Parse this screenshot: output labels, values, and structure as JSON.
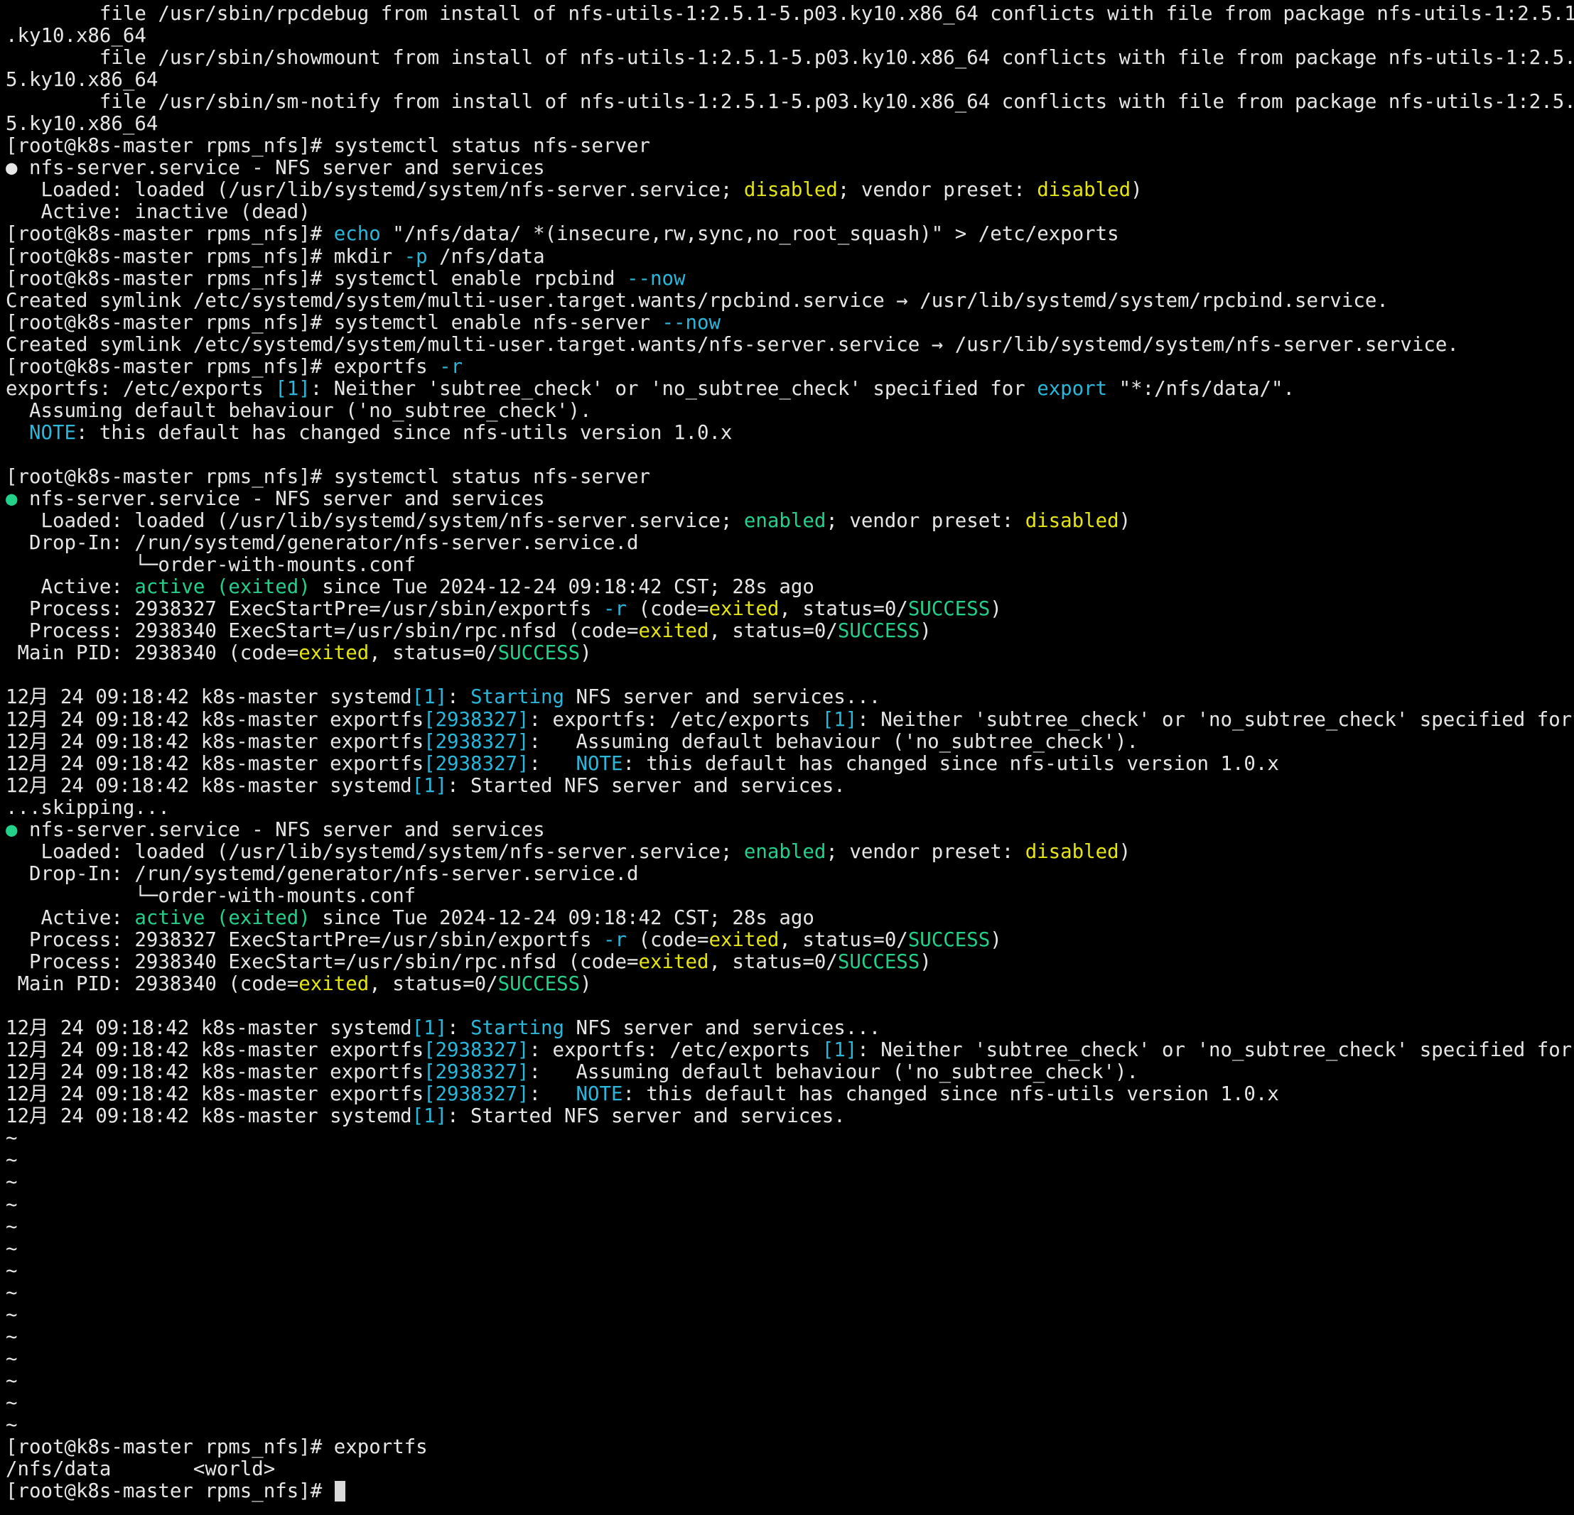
{
  "terminal": {
    "colors": {
      "background": "#000000",
      "foreground": "#e6e6e6",
      "yellow": "#e5e510",
      "cyan": "#29b8db",
      "green": "#23d18b"
    },
    "lines": [
      [
        {
          "t": "        file /usr/sbin/rpcdebug from install of nfs-utils-1:2.5.1-5.p03.ky10.x86_64 conflicts with file from package nfs-utils-1:2.5.1-5"
        }
      ],
      [
        {
          "t": ".ky10.x86_64"
        }
      ],
      [
        {
          "t": "        file /usr/sbin/showmount from install of nfs-utils-1:2.5.1-5.p03.ky10.x86_64 conflicts with file from package nfs-utils-1:2.5.1-"
        }
      ],
      [
        {
          "t": "5.ky10.x86_64"
        }
      ],
      [
        {
          "t": "        file /usr/sbin/sm-notify from install of nfs-utils-1:2.5.1-5.p03.ky10.x86_64 conflicts with file from package nfs-utils-1:2.5.1-"
        }
      ],
      [
        {
          "t": "5.ky10.x86_64"
        }
      ],
      [
        {
          "t": "[root@k8s-master rpms_nfs]# systemctl status nfs-server"
        }
      ],
      [
        {
          "t": "●",
          "c": "dot-w"
        },
        {
          "t": " nfs-server.service - NFS server and services"
        }
      ],
      [
        {
          "t": "   Loaded: loaded (/usr/lib/systemd/system/nfs-server.service; "
        },
        {
          "t": "disabled",
          "c": "y"
        },
        {
          "t": "; vendor preset: "
        },
        {
          "t": "disabled",
          "c": "y"
        },
        {
          "t": ")"
        }
      ],
      [
        {
          "t": "   Active: inactive (dead)"
        }
      ],
      [
        {
          "t": "[root@k8s-master rpms_nfs]# "
        },
        {
          "t": "echo",
          "c": "c"
        },
        {
          "t": " \"/nfs/data/ *(insecure,rw,sync,no_root_squash)\" > /etc/exports"
        }
      ],
      [
        {
          "t": "[root@k8s-master rpms_nfs]# mkdir "
        },
        {
          "t": "-p",
          "c": "c"
        },
        {
          "t": " /nfs/data"
        }
      ],
      [
        {
          "t": "[root@k8s-master rpms_nfs]# systemctl enable rpcbind "
        },
        {
          "t": "--now",
          "c": "c"
        }
      ],
      [
        {
          "t": "Created symlink /etc/systemd/system/multi-user.target.wants/rpcbind.service → /usr/lib/systemd/system/rpcbind.service."
        }
      ],
      [
        {
          "t": "[root@k8s-master rpms_nfs]# systemctl enable nfs-server "
        },
        {
          "t": "--now",
          "c": "c"
        }
      ],
      [
        {
          "t": "Created symlink /etc/systemd/system/multi-user.target.wants/nfs-server.service → /usr/lib/systemd/system/nfs-server.service."
        }
      ],
      [
        {
          "t": "[root@k8s-master rpms_nfs]# exportfs "
        },
        {
          "t": "-r",
          "c": "c"
        }
      ],
      [
        {
          "t": "exportfs: /etc/exports "
        },
        {
          "t": "[1]",
          "c": "c"
        },
        {
          "t": ": Neither 'subtree_check' or 'no_subtree_check' specified for "
        },
        {
          "t": "export",
          "c": "c"
        },
        {
          "t": " \"*:/nfs/data/\"."
        }
      ],
      [
        {
          "t": "  Assuming default behaviour ('no_subtree_check')."
        }
      ],
      [
        {
          "t": "  "
        },
        {
          "t": "NOTE",
          "c": "c"
        },
        {
          "t": ": this default has changed since nfs-utils version 1.0.x"
        }
      ],
      [
        {
          "t": ""
        }
      ],
      [
        {
          "t": "[root@k8s-master rpms_nfs]# systemctl status nfs-server"
        }
      ],
      [
        {
          "t": "●",
          "c": "dot-g"
        },
        {
          "t": " nfs-server.service - NFS server and services"
        }
      ],
      [
        {
          "t": "   Loaded: loaded (/usr/lib/systemd/system/nfs-server.service; "
        },
        {
          "t": "enabled",
          "c": "g"
        },
        {
          "t": "; vendor preset: "
        },
        {
          "t": "disabled",
          "c": "y"
        },
        {
          "t": ")"
        }
      ],
      [
        {
          "t": "  Drop-In: /run/systemd/generator/nfs-server.service.d"
        }
      ],
      [
        {
          "t": "           └─order-with-mounts.conf"
        }
      ],
      [
        {
          "t": "   Active: "
        },
        {
          "t": "active (exited)",
          "c": "g"
        },
        {
          "t": " since Tue 2024-12-24 09:18:42 CST; 28s ago"
        }
      ],
      [
        {
          "t": "  Process: 2938327 ExecStartPre=/usr/sbin/exportfs "
        },
        {
          "t": "-r",
          "c": "c"
        },
        {
          "t": " (code="
        },
        {
          "t": "exited",
          "c": "y"
        },
        {
          "t": ", status=0/"
        },
        {
          "t": "SUCCESS",
          "c": "g"
        },
        {
          "t": ")"
        }
      ],
      [
        {
          "t": "  Process: 2938340 ExecStart=/usr/sbin/rpc.nfsd (code="
        },
        {
          "t": "exited",
          "c": "y"
        },
        {
          "t": ", status=0/"
        },
        {
          "t": "SUCCESS",
          "c": "g"
        },
        {
          "t": ")"
        }
      ],
      [
        {
          "t": " Main PID: 2938340 (code="
        },
        {
          "t": "exited",
          "c": "y"
        },
        {
          "t": ", status=0/"
        },
        {
          "t": "SUCCESS",
          "c": "g"
        },
        {
          "t": ")"
        }
      ],
      [
        {
          "t": ""
        }
      ],
      [
        {
          "t": "12月 24 09:18:42 k8s-master systemd"
        },
        {
          "t": "[1]",
          "c": "c"
        },
        {
          "t": ": "
        },
        {
          "t": "Starting",
          "c": "c"
        },
        {
          "t": " NFS server and services..."
        }
      ],
      [
        {
          "t": "12月 24 09:18:42 k8s-master exportfs"
        },
        {
          "t": "[2938327]",
          "c": "c"
        },
        {
          "t": ": exportfs: /etc/exports "
        },
        {
          "t": "[1]",
          "c": "c"
        },
        {
          "t": ": Neither 'subtree_check' or 'no_subtree_check' specified for "
        },
        {
          "t": ">",
          "c": "rev"
        }
      ],
      [
        {
          "t": "12月 24 09:18:42 k8s-master exportfs"
        },
        {
          "t": "[2938327]",
          "c": "c"
        },
        {
          "t": ":   Assuming default behaviour ('no_subtree_check')."
        }
      ],
      [
        {
          "t": "12月 24 09:18:42 k8s-master exportfs"
        },
        {
          "t": "[2938327]",
          "c": "c"
        },
        {
          "t": ":   "
        },
        {
          "t": "NOTE",
          "c": "c"
        },
        {
          "t": ": this default has changed since nfs-utils version 1.0.x"
        }
      ],
      [
        {
          "t": "12月 24 09:18:42 k8s-master systemd"
        },
        {
          "t": "[1]",
          "c": "c"
        },
        {
          "t": ": Started NFS server and services."
        }
      ],
      [
        {
          "t": "...skipping..."
        }
      ],
      [
        {
          "t": "●",
          "c": "dot-g"
        },
        {
          "t": " nfs-server.service - NFS server and services"
        }
      ],
      [
        {
          "t": "   Loaded: loaded (/usr/lib/systemd/system/nfs-server.service; "
        },
        {
          "t": "enabled",
          "c": "g"
        },
        {
          "t": "; vendor preset: "
        },
        {
          "t": "disabled",
          "c": "y"
        },
        {
          "t": ")"
        }
      ],
      [
        {
          "t": "  Drop-In: /run/systemd/generator/nfs-server.service.d"
        }
      ],
      [
        {
          "t": "           └─order-with-mounts.conf"
        }
      ],
      [
        {
          "t": "   Active: "
        },
        {
          "t": "active (exited)",
          "c": "g"
        },
        {
          "t": " since Tue 2024-12-24 09:18:42 CST; 28s ago"
        }
      ],
      [
        {
          "t": "  Process: 2938327 ExecStartPre=/usr/sbin/exportfs "
        },
        {
          "t": "-r",
          "c": "c"
        },
        {
          "t": " (code="
        },
        {
          "t": "exited",
          "c": "y"
        },
        {
          "t": ", status=0/"
        },
        {
          "t": "SUCCESS",
          "c": "g"
        },
        {
          "t": ")"
        }
      ],
      [
        {
          "t": "  Process: 2938340 ExecStart=/usr/sbin/rpc.nfsd (code="
        },
        {
          "t": "exited",
          "c": "y"
        },
        {
          "t": ", status=0/"
        },
        {
          "t": "SUCCESS",
          "c": "g"
        },
        {
          "t": ")"
        }
      ],
      [
        {
          "t": " Main PID: 2938340 (code="
        },
        {
          "t": "exited",
          "c": "y"
        },
        {
          "t": ", status=0/"
        },
        {
          "t": "SUCCESS",
          "c": "g"
        },
        {
          "t": ")"
        }
      ],
      [
        {
          "t": ""
        }
      ],
      [
        {
          "t": "12月 24 09:18:42 k8s-master systemd"
        },
        {
          "t": "[1]",
          "c": "c"
        },
        {
          "t": ": "
        },
        {
          "t": "Starting",
          "c": "c"
        },
        {
          "t": " NFS server and services..."
        }
      ],
      [
        {
          "t": "12月 24 09:18:42 k8s-master exportfs"
        },
        {
          "t": "[2938327]",
          "c": "c"
        },
        {
          "t": ": exportfs: /etc/exports "
        },
        {
          "t": "[1]",
          "c": "c"
        },
        {
          "t": ": Neither 'subtree_check' or 'no_subtree_check' specified for "
        },
        {
          "t": ">",
          "c": "rev"
        }
      ],
      [
        {
          "t": "12月 24 09:18:42 k8s-master exportfs"
        },
        {
          "t": "[2938327]",
          "c": "c"
        },
        {
          "t": ":   Assuming default behaviour ('no_subtree_check')."
        }
      ],
      [
        {
          "t": "12月 24 09:18:42 k8s-master exportfs"
        },
        {
          "t": "[2938327]",
          "c": "c"
        },
        {
          "t": ":   "
        },
        {
          "t": "NOTE",
          "c": "c"
        },
        {
          "t": ": this default has changed since nfs-utils version 1.0.x"
        }
      ],
      [
        {
          "t": "12月 24 09:18:42 k8s-master systemd"
        },
        {
          "t": "[1]",
          "c": "c"
        },
        {
          "t": ": Started NFS server and services."
        }
      ],
      [
        {
          "t": "~"
        }
      ],
      [
        {
          "t": "~"
        }
      ],
      [
        {
          "t": "~"
        }
      ],
      [
        {
          "t": "~"
        }
      ],
      [
        {
          "t": "~"
        }
      ],
      [
        {
          "t": "~"
        }
      ],
      [
        {
          "t": "~"
        }
      ],
      [
        {
          "t": "~"
        }
      ],
      [
        {
          "t": "~"
        }
      ],
      [
        {
          "t": "~"
        }
      ],
      [
        {
          "t": "~"
        }
      ],
      [
        {
          "t": "~"
        }
      ],
      [
        {
          "t": "~"
        }
      ],
      [
        {
          "t": "~"
        }
      ],
      [
        {
          "t": "[root@k8s-master rpms_nfs]# exportfs"
        }
      ],
      [
        {
          "t": "/nfs/data       <world>"
        }
      ],
      [
        {
          "t": "[root@k8s-master rpms_nfs]# "
        },
        {
          "t": "",
          "c": "cursor"
        }
      ]
    ]
  }
}
